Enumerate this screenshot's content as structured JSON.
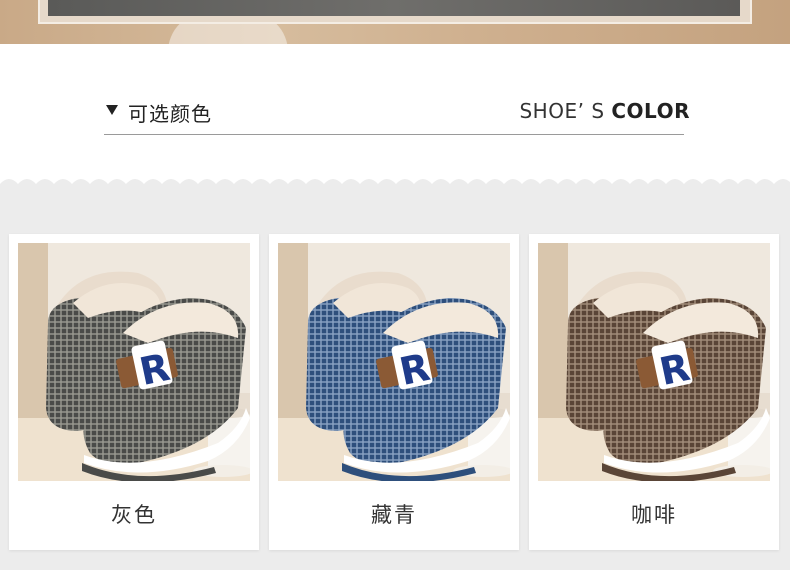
{
  "section": {
    "title_cn": "可选颜色",
    "title_en_light": "SHOE’ S",
    "title_en_bold": "COLOR"
  },
  "colors": [
    {
      "label": "灰色",
      "accent": "#4a4b49",
      "check": "#9a9a92",
      "icon": "slipper-photo"
    },
    {
      "label": "藏青",
      "accent": "#2e4f7c",
      "check": "#8aa3c4",
      "icon": "slipper-photo"
    },
    {
      "label": "咖啡",
      "accent": "#5a4537",
      "check": "#a48f7c",
      "icon": "slipper-photo"
    }
  ]
}
